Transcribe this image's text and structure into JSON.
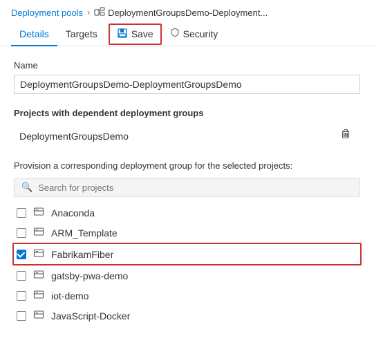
{
  "breadcrumb": {
    "link": "Deployment pools",
    "separator": "›",
    "icon_label": "deployment-groups-icon",
    "current": "DeploymentGroupsDemo-Deployment..."
  },
  "tabs": [
    {
      "label": "Details",
      "active": true
    },
    {
      "label": "Targets",
      "active": false
    }
  ],
  "save_button": {
    "label": "Save"
  },
  "security_tab": {
    "label": "Security"
  },
  "name_field": {
    "label": "Name",
    "value": "DeploymentGroupsDemo-DeploymentGroupsDemo"
  },
  "dependent_projects": {
    "title": "Projects with dependent deployment groups",
    "project": "DeploymentGroupsDemo",
    "delete_label": "delete"
  },
  "provision": {
    "label": "Provision a corresponding deployment group for the selected projects:",
    "search_placeholder": "Search for projects"
  },
  "project_list": [
    {
      "name": "Anaconda",
      "checked": false
    },
    {
      "name": "ARM_Template",
      "checked": false
    },
    {
      "name": "FabrikamFiber",
      "checked": true,
      "highlight": true
    },
    {
      "name": "gatsby-pwa-demo",
      "checked": false
    },
    {
      "name": "iot-demo",
      "checked": false
    },
    {
      "name": "JavaScript-Docker",
      "checked": false
    }
  ]
}
